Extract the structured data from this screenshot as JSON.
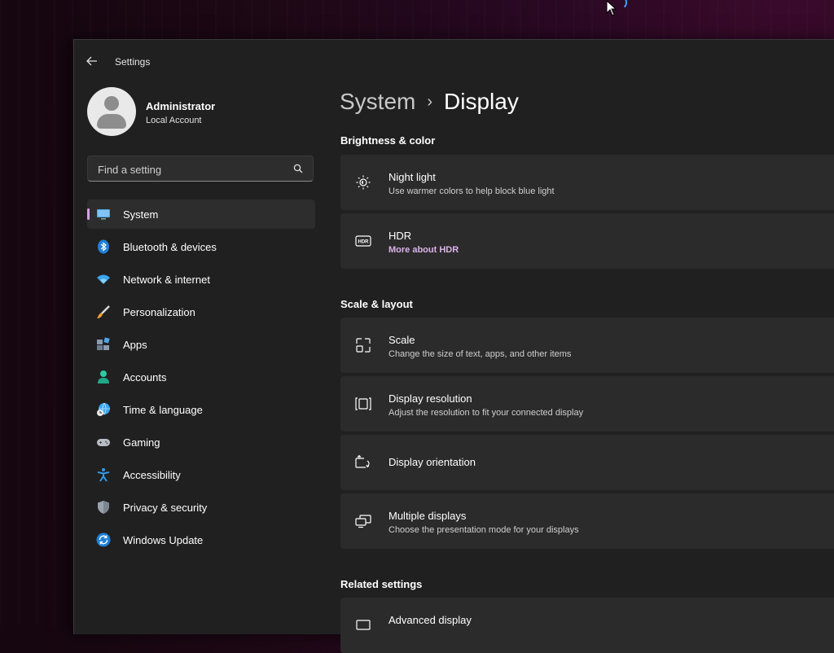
{
  "window": {
    "title": "Settings"
  },
  "user": {
    "name": "Administrator",
    "account_type": "Local Account"
  },
  "search": {
    "placeholder": "Find a setting"
  },
  "sidebar": {
    "items": [
      {
        "label": "System",
        "icon": "monitor-icon",
        "active": true
      },
      {
        "label": "Bluetooth & devices",
        "icon": "bluetooth-icon"
      },
      {
        "label": "Network & internet",
        "icon": "wifi-icon"
      },
      {
        "label": "Personalization",
        "icon": "brush-icon"
      },
      {
        "label": "Apps",
        "icon": "apps-icon"
      },
      {
        "label": "Accounts",
        "icon": "person-icon"
      },
      {
        "label": "Time & language",
        "icon": "globe-clock-icon"
      },
      {
        "label": "Gaming",
        "icon": "gamepad-icon"
      },
      {
        "label": "Accessibility",
        "icon": "accessibility-icon"
      },
      {
        "label": "Privacy & security",
        "icon": "shield-icon"
      },
      {
        "label": "Windows Update",
        "icon": "update-icon"
      }
    ]
  },
  "breadcrumb": {
    "parent": "System",
    "separator": "›",
    "current": "Display"
  },
  "sections": {
    "brightness": {
      "title": "Brightness & color",
      "cards": [
        {
          "title": "Night light",
          "subtitle": "Use warmer colors to help block blue light",
          "icon": "night-light-icon"
        },
        {
          "title": "HDR",
          "link": "More about HDR",
          "icon": "hdr-icon"
        }
      ]
    },
    "scale": {
      "title": "Scale & layout",
      "cards": [
        {
          "title": "Scale",
          "subtitle": "Change the size of text, apps, and other items",
          "icon": "scale-icon"
        },
        {
          "title": "Display resolution",
          "subtitle": "Adjust the resolution to fit your connected display",
          "icon": "resolution-icon"
        },
        {
          "title": "Display orientation",
          "icon": "orientation-icon"
        },
        {
          "title": "Multiple displays",
          "subtitle": "Choose the presentation mode for your displays",
          "icon": "multiple-displays-icon"
        }
      ]
    },
    "related": {
      "title": "Related settings",
      "cards": [
        {
          "title": "Advanced display",
          "icon": "advanced-display-icon"
        }
      ]
    }
  },
  "colors": {
    "accent": "#d6a0e8",
    "link": "#dcb2ea",
    "window_bg": "#202020",
    "card_bg": "#2b2b2b"
  }
}
